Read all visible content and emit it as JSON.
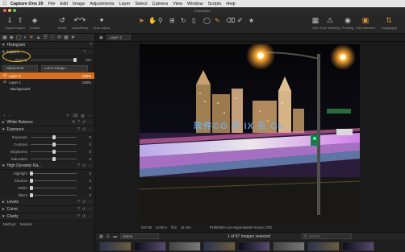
{
  "menubar": {
    "apple": "",
    "items": [
      "Capture One 20",
      "File",
      "Edit",
      "Image",
      "Adjustments",
      "Layer",
      "Select",
      "Camera",
      "View",
      "Window",
      "Scripts",
      "Help"
    ]
  },
  "window": {
    "title": "Inventario"
  },
  "toolbar": {
    "left_buttons": [
      {
        "label": "Import",
        "icon": "import-icon"
      },
      {
        "label": "Export",
        "icon": "export-icon"
      },
      {
        "label": "Cookie",
        "icon": "cookie-icon"
      },
      {
        "label": "Reset",
        "icon": "reset-icon"
      },
      {
        "label": "Undo/Redo",
        "icon": "undo-icon"
      },
      {
        "label": "Auto Adjust",
        "icon": "auto-adjust-icon"
      }
    ],
    "tools_label": "Cursor Tools",
    "right_buttons": [
      {
        "label": "Grid",
        "icon": "grid-icon"
      },
      {
        "label": "Exp. Warning",
        "icon": "exposure-warning-icon"
      },
      {
        "label": "Proofing",
        "icon": "proofing-icon"
      },
      {
        "label": "Edit Selected",
        "icon": "edit-selected-icon"
      },
      {
        "label": "CopyApply",
        "icon": "copy-apply-icon"
      }
    ]
  },
  "left_panel": {
    "histogram_label": "Histogram",
    "histogram_value": "?",
    "layers_label": "Layers",
    "opacity_label": "Opacity",
    "opacity_value": "100",
    "adjustment_btn": "Adjustment",
    "luma_btn": "Luma Range...",
    "layers": [
      {
        "name": "Layer 2",
        "pct": "100%",
        "selected": true
      },
      {
        "name": "Layer 1",
        "pct": "100%",
        "selected": false
      },
      {
        "name": "Background",
        "pct": "",
        "selected": false
      }
    ],
    "white_balance": "White Balance",
    "exposure": {
      "title": "Exposure",
      "sliders": [
        {
          "label": "Exposure",
          "value": "0",
          "pos": 0.5
        },
        {
          "label": "Contrast",
          "value": "0",
          "pos": 0.5
        },
        {
          "label": "Brightness",
          "value": "0",
          "pos": 0.5
        },
        {
          "label": "Saturation",
          "value": "0",
          "pos": 0.5
        }
      ]
    },
    "hdr": {
      "title": "High Dynamic Ra...",
      "sliders": [
        {
          "label": "Highlight",
          "value": "0",
          "pos": 0.02
        },
        {
          "label": "Shadow",
          "value": "0",
          "pos": 0.02
        },
        {
          "label": "White",
          "value": "0",
          "pos": 0.02
        },
        {
          "label": "Black",
          "value": "0",
          "pos": 0.02
        }
      ]
    },
    "bottom_sections": [
      "Levels",
      "Curve",
      "Clarity"
    ],
    "clarity_row": [
      "Method",
      "Natural"
    ]
  },
  "viewer": {
    "layer_select": "Layer 2",
    "info": [
      "ISO 80",
      "24.90 s",
      "f/16",
      "16 mm",
      "P1050600-Las-Vegas-Bartek-Scenic.CR3"
    ],
    "watermark": "软件CG 不 IX 乐 Cn",
    "count": "1 of 87 Images selected",
    "sort": "Name",
    "search_placeholder": "Search"
  },
  "colors": {
    "accent": "#e0922e",
    "selection": "#d8701f",
    "circle": "#f2c12e"
  }
}
